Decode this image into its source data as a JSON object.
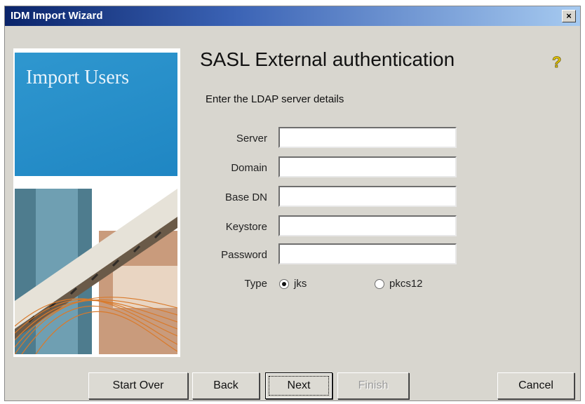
{
  "window": {
    "title": "IDM Import Wizard",
    "close_label": "×"
  },
  "sidebar": {
    "title": "Import Users"
  },
  "main": {
    "heading": "SASL External authentication",
    "subtitle": "Enter the LDAP server details",
    "fields": [
      {
        "label": "Server",
        "value": ""
      },
      {
        "label": "Domain",
        "value": ""
      },
      {
        "label": "Base DN",
        "value": ""
      },
      {
        "label": "Keystore",
        "value": ""
      },
      {
        "label": "Password",
        "value": ""
      }
    ],
    "type": {
      "label": "Type",
      "options": [
        {
          "label": "jks",
          "checked": true
        },
        {
          "label": "pkcs12",
          "checked": false
        }
      ]
    }
  },
  "buttons": {
    "start_over": "Start Over",
    "back": "Back",
    "next": "Next",
    "finish": "Finish",
    "cancel": "Cancel"
  },
  "colors": {
    "titlebar": "#0a246a",
    "panel": "#2f97cf",
    "help": "#e8c800"
  },
  "icons": {
    "help": "question-mark-icon",
    "close": "close-icon"
  }
}
